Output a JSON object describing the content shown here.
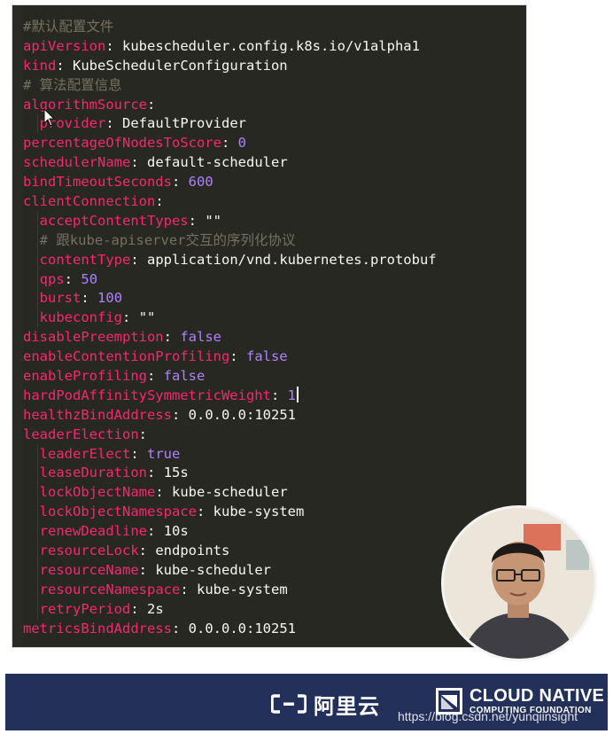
{
  "editor": {
    "lines": [
      {
        "type": "comment",
        "indent": 0,
        "text": "#默认配置文件"
      },
      {
        "type": "kv",
        "indent": 0,
        "key": "apiVersion",
        "value": "kubescheduler.config.k8s.io/v1alpha1",
        "vtype": "str"
      },
      {
        "type": "kv",
        "indent": 0,
        "key": "kind",
        "value": "KubeSchedulerConfiguration",
        "vtype": "str"
      },
      {
        "type": "comment",
        "indent": 0,
        "text": "# 算法配置信息"
      },
      {
        "type": "kv",
        "indent": 0,
        "key": "algorithmSource",
        "value": "",
        "vtype": "str"
      },
      {
        "type": "kv",
        "indent": 1,
        "key": "provider",
        "value": "DefaultProvider",
        "vtype": "str"
      },
      {
        "type": "kv",
        "indent": 0,
        "key": "percentageOfNodesToScore",
        "value": "0",
        "vtype": "num"
      },
      {
        "type": "kv",
        "indent": 0,
        "key": "schedulerName",
        "value": "default-scheduler",
        "vtype": "str"
      },
      {
        "type": "kv",
        "indent": 0,
        "key": "bindTimeoutSeconds",
        "value": "600",
        "vtype": "num"
      },
      {
        "type": "kv",
        "indent": 0,
        "key": "clientConnection",
        "value": "",
        "vtype": "str"
      },
      {
        "type": "kv",
        "indent": 1,
        "key": "acceptContentTypes",
        "value": "\"\"",
        "vtype": "str"
      },
      {
        "type": "comment",
        "indent": 1,
        "text": "# 跟kube-apiserver交互的序列化协议"
      },
      {
        "type": "kv",
        "indent": 1,
        "key": "contentType",
        "value": "application/vnd.kubernetes.protobuf",
        "vtype": "str"
      },
      {
        "type": "kv",
        "indent": 1,
        "key": "qps",
        "value": "50",
        "vtype": "num"
      },
      {
        "type": "kv",
        "indent": 1,
        "key": "burst",
        "value": "100",
        "vtype": "num"
      },
      {
        "type": "kv",
        "indent": 1,
        "key": "kubeconfig",
        "value": "\"\"",
        "vtype": "str"
      },
      {
        "type": "kv",
        "indent": 0,
        "key": "disablePreemption",
        "value": "false",
        "vtype": "bool"
      },
      {
        "type": "kv",
        "indent": 0,
        "key": "enableContentionProfiling",
        "value": "false",
        "vtype": "bool"
      },
      {
        "type": "kv",
        "indent": 0,
        "key": "enableProfiling",
        "value": "false",
        "vtype": "bool"
      },
      {
        "type": "kv",
        "indent": 0,
        "key": "hardPodAffinitySymmetricWeight",
        "value": "1",
        "vtype": "num",
        "caret": true
      },
      {
        "type": "kv",
        "indent": 0,
        "key": "healthzBindAddress",
        "value": "0.0.0.0:10251",
        "vtype": "str"
      },
      {
        "type": "kv",
        "indent": 0,
        "key": "leaderElection",
        "value": "",
        "vtype": "str"
      },
      {
        "type": "kv",
        "indent": 1,
        "key": "leaderElect",
        "value": "true",
        "vtype": "bool"
      },
      {
        "type": "kv",
        "indent": 1,
        "key": "leaseDuration",
        "value": "15s",
        "vtype": "str"
      },
      {
        "type": "kv",
        "indent": 1,
        "key": "lockObjectName",
        "value": "kube-scheduler",
        "vtype": "str"
      },
      {
        "type": "kv",
        "indent": 1,
        "key": "lockObjectNamespace",
        "value": "kube-system",
        "vtype": "str"
      },
      {
        "type": "kv",
        "indent": 1,
        "key": "renewDeadline",
        "value": "10s",
        "vtype": "str"
      },
      {
        "type": "kv",
        "indent": 1,
        "key": "resourceLock",
        "value": "endpoints",
        "vtype": "str"
      },
      {
        "type": "kv",
        "indent": 1,
        "key": "resourceName",
        "value": "kube-scheduler",
        "vtype": "str"
      },
      {
        "type": "kv",
        "indent": 1,
        "key": "resourceNamespace",
        "value": "kube-system",
        "vtype": "str"
      },
      {
        "type": "kv",
        "indent": 1,
        "key": "retryPeriod",
        "value": "2s",
        "vtype": "str"
      },
      {
        "type": "kv",
        "indent": 0,
        "key": "metricsBindAddress",
        "value": "0.0.0.0:10251",
        "vtype": "str"
      }
    ]
  },
  "colors": {
    "editor_bg": "#272822",
    "key": "#f92672",
    "text": "#f8f8f2",
    "number": "#ae81ff",
    "comment": "#75715e",
    "footer_bg": "#22305a"
  },
  "webcam": {
    "icon": "presenter-video"
  },
  "footer": {
    "aliyun_label": "阿里云",
    "cncf_title": "CLOUD NATIVE",
    "cncf_subtitle": "COMPUTING FOUNDATION",
    "watermark": "https://blog.csdn.net/yunqiinsight"
  }
}
